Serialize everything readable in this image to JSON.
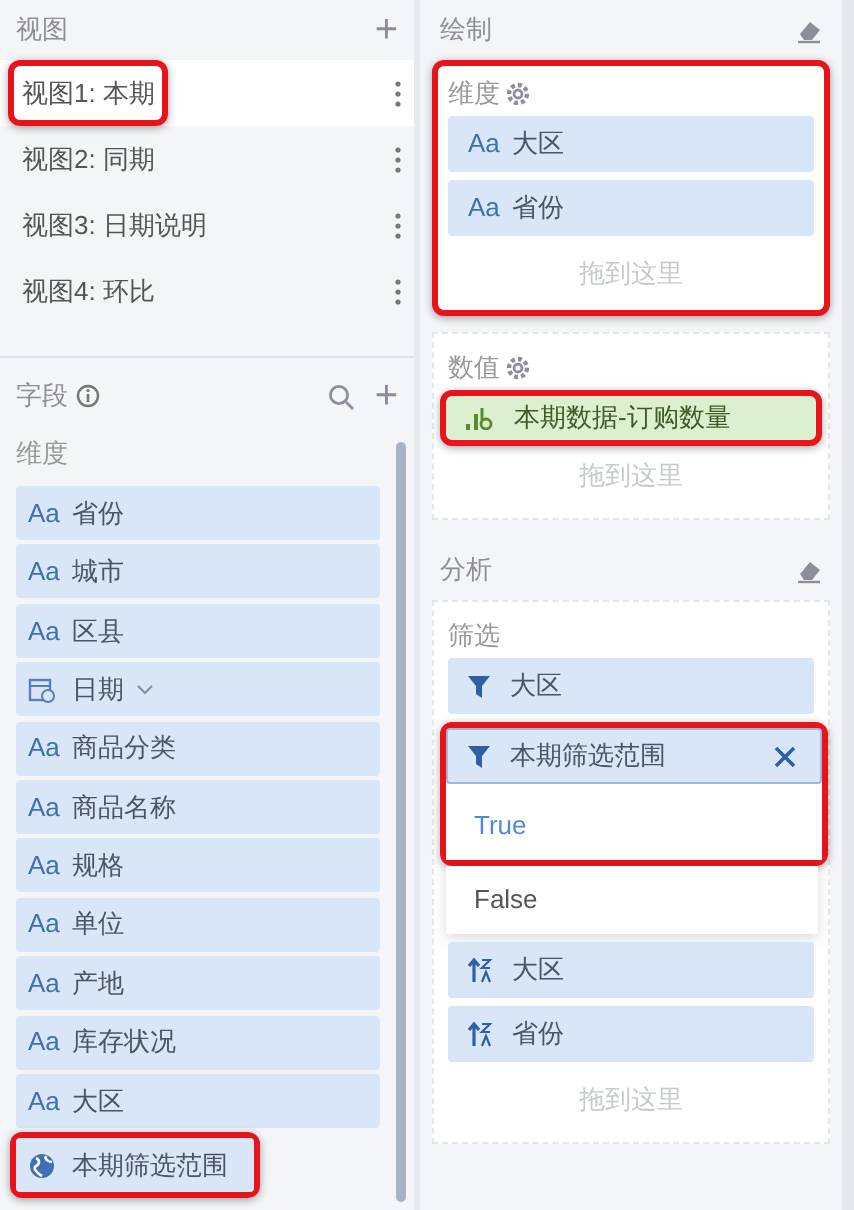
{
  "views": {
    "title": "视图",
    "add": "+",
    "items": [
      {
        "label": "视图1: 本期",
        "selected": true,
        "highlighted": true
      },
      {
        "label": "视图2: 同期",
        "selected": false,
        "highlighted": false
      },
      {
        "label": "视图3: 日期说明",
        "selected": false,
        "highlighted": false
      },
      {
        "label": "视图4: 环比",
        "selected": false,
        "highlighted": false
      }
    ]
  },
  "fields": {
    "title": "字段",
    "add": "+",
    "section": "维度",
    "items": [
      {
        "kind": "text",
        "type_icon": "Aa",
        "label": "省份",
        "highlighted": false
      },
      {
        "kind": "text",
        "type_icon": "Aa",
        "label": "城市",
        "highlighted": false
      },
      {
        "kind": "text",
        "type_icon": "Aa",
        "label": "区县",
        "highlighted": false
      },
      {
        "kind": "date",
        "label": "日期",
        "highlighted": false
      },
      {
        "kind": "text",
        "type_icon": "Aa",
        "label": "商品分类",
        "highlighted": false
      },
      {
        "kind": "text",
        "type_icon": "Aa",
        "label": "商品名称",
        "highlighted": false
      },
      {
        "kind": "text",
        "type_icon": "Aa",
        "label": "规格",
        "highlighted": false
      },
      {
        "kind": "text",
        "type_icon": "Aa",
        "label": "单位",
        "highlighted": false
      },
      {
        "kind": "text",
        "type_icon": "Aa",
        "label": "产地",
        "highlighted": false
      },
      {
        "kind": "text",
        "type_icon": "Aa",
        "label": "库存状况",
        "highlighted": false
      },
      {
        "kind": "text",
        "type_icon": "Aa",
        "label": "大区",
        "highlighted": false
      },
      {
        "kind": "geo",
        "label": "本期筛选范围",
        "highlighted": true
      }
    ]
  },
  "draw": {
    "title": "绘制",
    "dimension": {
      "title": "维度",
      "highlighted": true,
      "chips": [
        {
          "type_icon": "Aa",
          "label": "大区"
        },
        {
          "type_icon": "Aa",
          "label": "省份"
        }
      ],
      "drop_hint": "拖到这里"
    },
    "value": {
      "title": "数值",
      "chips": [
        {
          "label": "本期数据-订购数量",
          "highlighted": true
        }
      ],
      "drop_hint": "拖到这里"
    }
  },
  "analysis": {
    "title": "分析",
    "filter": {
      "title": "筛选",
      "chips": [
        {
          "label": "大区",
          "open": false,
          "highlighted": false
        },
        {
          "label": "本期筛选范围",
          "open": true,
          "highlighted": true,
          "options": [
            {
              "label": "True",
              "selected": true
            },
            {
              "label": "False",
              "selected": false
            }
          ]
        }
      ]
    },
    "sort": {
      "chips": [
        {
          "label": "大区"
        },
        {
          "label": "省份"
        }
      ],
      "drop_hint": "拖到这里"
    }
  }
}
